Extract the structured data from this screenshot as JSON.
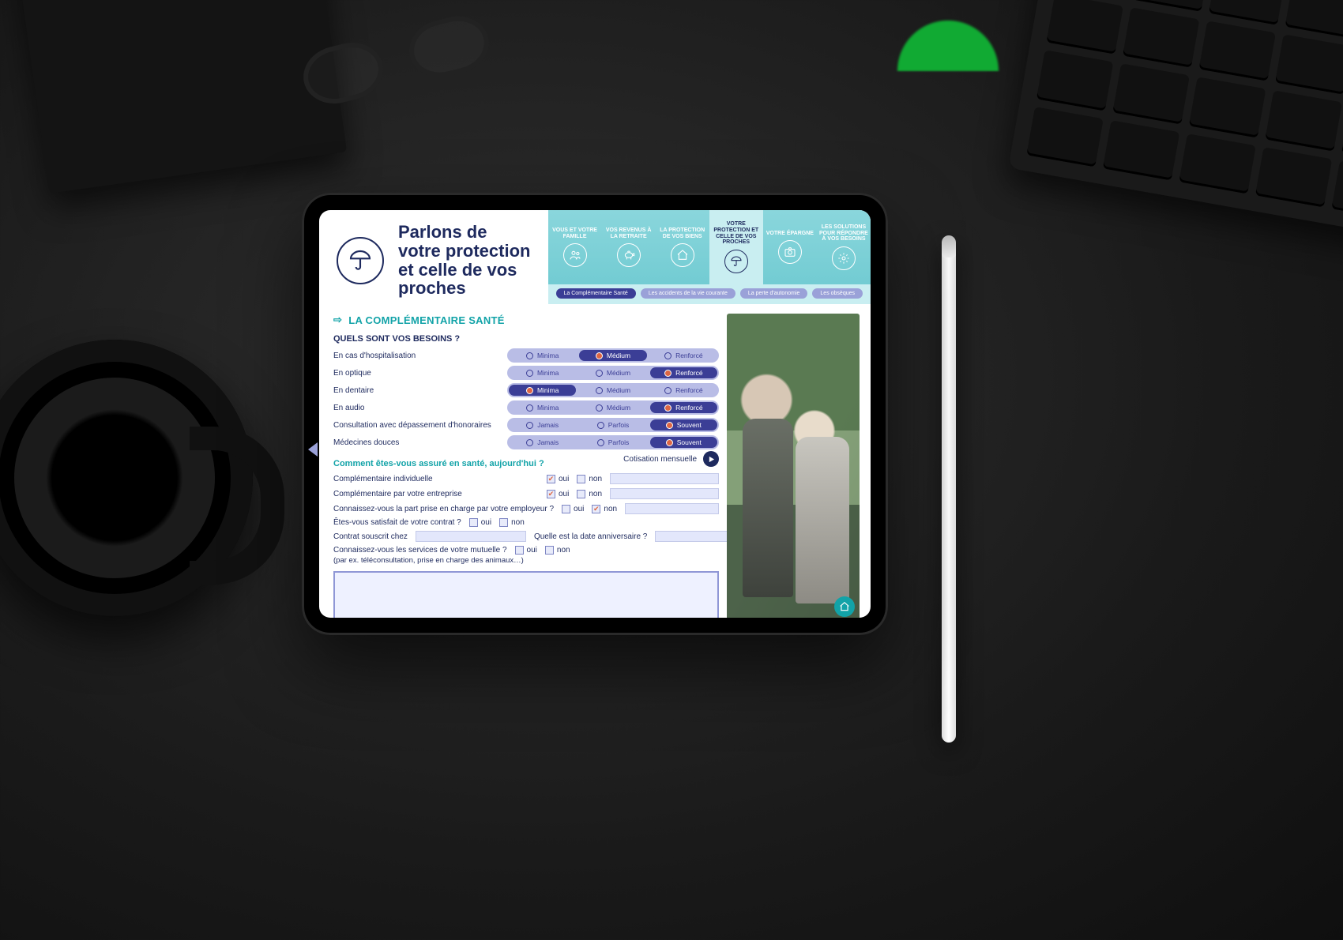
{
  "page_title": "Parlons de votre protection et celle de vos proches",
  "nav": [
    {
      "label": "VOUS ET VOTRE FAMILLE",
      "icon": "users"
    },
    {
      "label": "VOS REVENUS À LA RETRAITE",
      "icon": "piggy"
    },
    {
      "label": "LA PROTECTION DE VOS BIENS",
      "icon": "home"
    },
    {
      "label": "VOTRE PROTECTION ET CELLE DE VOS PROCHES",
      "icon": "umbrella",
      "active": true
    },
    {
      "label": "VOTRE ÉPARGNE",
      "icon": "camera"
    },
    {
      "label": "LES SOLUTIONS POUR RÉPONDRE À VOS BESOINS",
      "icon": "gear"
    }
  ],
  "subnav": [
    {
      "label": "La Complémentaire Santé",
      "active": true
    },
    {
      "label": "Les accidents de la vie courante"
    },
    {
      "label": "La perte d'autonomie"
    },
    {
      "label": "Les obsèques"
    }
  ],
  "section_title": "LA COMPLÉMENTAIRE SANTÉ",
  "needs_heading": "QUELS SONT VOS BESOINS ?",
  "need_options_3": [
    "Minima",
    "Médium",
    "Renforcé"
  ],
  "need_options_freq": [
    "Jamais",
    "Parfois",
    "Souvent"
  ],
  "needs": [
    {
      "label": "En cas d'hospitalisation",
      "opts": "need_options_3",
      "selected": 1
    },
    {
      "label": "En optique",
      "opts": "need_options_3",
      "selected": 2
    },
    {
      "label": "En dentaire",
      "opts": "need_options_3",
      "selected": 0
    },
    {
      "label": "En audio",
      "opts": "need_options_3",
      "selected": 2
    },
    {
      "label": "Consultation avec dépassement d'honoraires",
      "opts": "need_options_freq",
      "selected": 2
    },
    {
      "label": "Médecines douces",
      "opts": "need_options_freq",
      "selected": 2
    }
  ],
  "insured_heading": "Comment êtes-vous assuré en santé, aujourd'hui ?",
  "cotisation_label": "Cotisation mensuelle",
  "yes": "oui",
  "no": "non",
  "q_individual": "Complémentaire individuelle",
  "q_company": "Complémentaire par votre entreprise",
  "q_employer_share": "Connaissez-vous la part prise en charge par votre employeur ?",
  "q_satisfied": "Êtes-vous satisfait de votre contrat ?",
  "q_contract_at": "Contrat souscrit chez",
  "q_anniv": "Quelle est la date anniversaire ?",
  "q_services": "Connaissez-vous les services de votre mutuelle ?",
  "q_services_hint": "(par ex. téléconsultation, prise en charge des animaux…)",
  "answers": {
    "individual": "oui",
    "company": "oui",
    "employer_share": "non"
  }
}
